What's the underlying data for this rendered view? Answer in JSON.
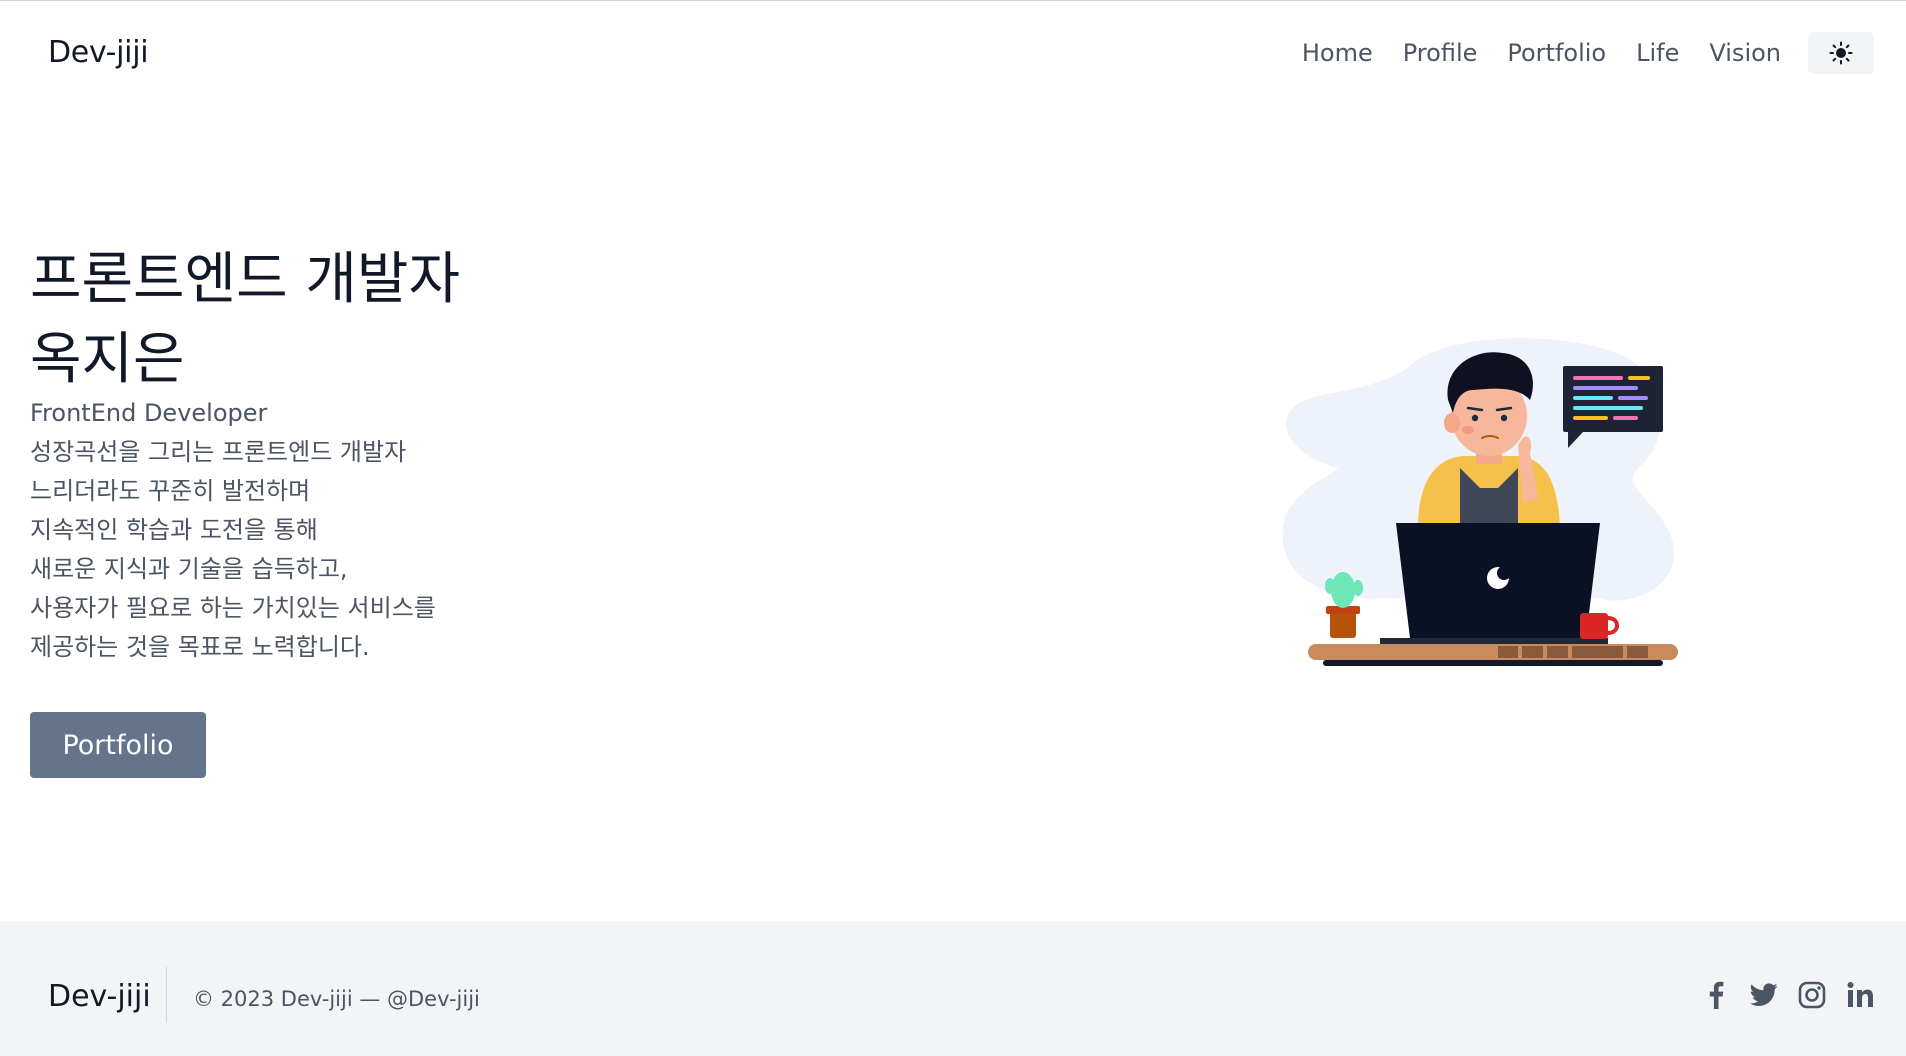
{
  "header": {
    "brand": "Dev-jiji",
    "nav": [
      "Home",
      "Profile",
      "Portfolio",
      "Life",
      "Vision"
    ],
    "theme_icon": "sun-icon"
  },
  "hero": {
    "title_lines": [
      "프론트엔드 개발자",
      "옥지은"
    ],
    "description_lines": [
      "FrontEnd Developer",
      "성장곡선을 그리는 프론트엔드 개발자",
      "느리더라도 꾸준히 발전하며",
      "지속적인 학습과 도전을 통해",
      "새로운 지식과 기술을 습득하고,",
      "사용자가 필요로 하는 가치있는 서비스를",
      "제공하는 것을 목표로 노력합니다."
    ],
    "cta_label": "Portfolio",
    "illustration": "developer-at-laptop-illustration"
  },
  "footer": {
    "brand": "Dev-jiji",
    "copyright": "© 2023 Dev-jiji — @Dev-jiji",
    "socials": [
      "facebook-icon",
      "twitter-icon",
      "instagram-icon",
      "linkedin-icon"
    ]
  },
  "colors": {
    "text": "#111827",
    "muted": "#4b5563",
    "button": "#64748b",
    "footer_bg": "#f3f4f6"
  }
}
